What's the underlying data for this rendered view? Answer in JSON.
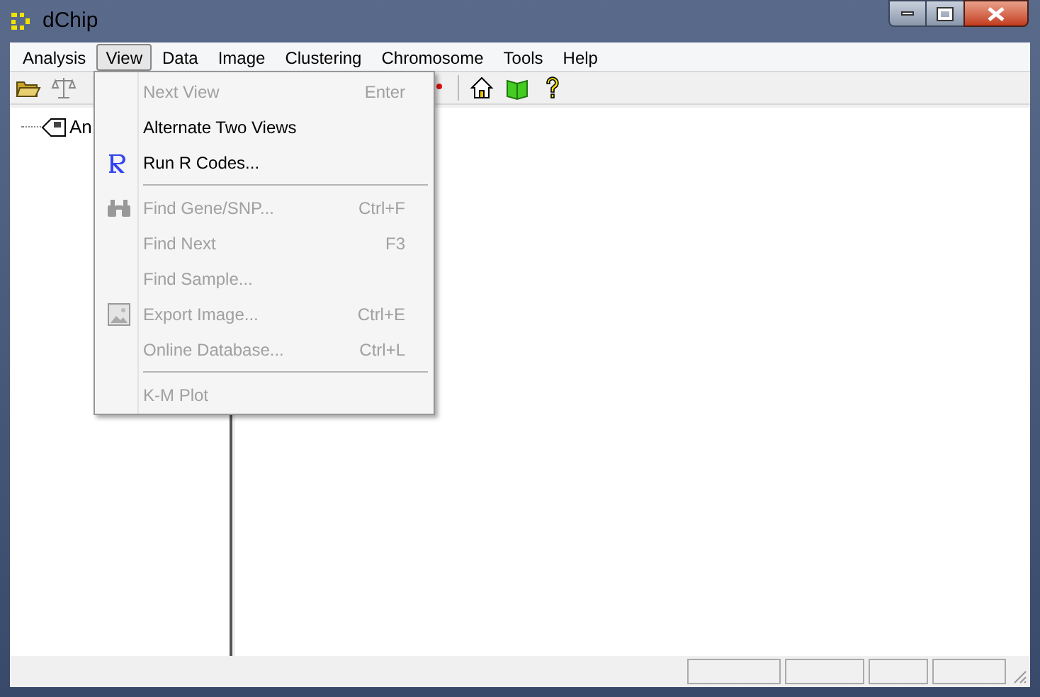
{
  "window": {
    "title": "dChip"
  },
  "menu_bar": [
    {
      "label": "Analysis",
      "selected": false
    },
    {
      "label": "View",
      "selected": true
    },
    {
      "label": "Data",
      "selected": false
    },
    {
      "label": "Image",
      "selected": false
    },
    {
      "label": "Clustering",
      "selected": false
    },
    {
      "label": "Chromosome",
      "selected": false
    },
    {
      "label": "Tools",
      "selected": false
    },
    {
      "label": "Help",
      "selected": false
    }
  ],
  "tree": {
    "items": [
      {
        "label": "An"
      }
    ]
  },
  "view_menu": [
    {
      "kind": "item",
      "label": "Next View",
      "shortcut": "Enter",
      "disabled": true
    },
    {
      "kind": "item",
      "label": "Alternate Two Views",
      "disabled": false
    },
    {
      "kind": "item",
      "label": "Run R Codes...",
      "disabled": false
    },
    {
      "kind": "separator"
    },
    {
      "kind": "item",
      "label": "Find Gene/SNP...",
      "shortcut": "Ctrl+F",
      "disabled": true
    },
    {
      "kind": "item",
      "label": "Find Next",
      "shortcut": "F3",
      "disabled": true
    },
    {
      "kind": "item",
      "label": "Find Sample...",
      "disabled": true
    },
    {
      "kind": "item",
      "label": "Export Image...",
      "shortcut": "Ctrl+E",
      "disabled": true
    },
    {
      "kind": "item",
      "label": "Online Database...",
      "shortcut": "Ctrl+L",
      "disabled": true
    },
    {
      "kind": "separator"
    },
    {
      "kind": "item",
      "label": "K-M Plot",
      "disabled": true
    }
  ]
}
